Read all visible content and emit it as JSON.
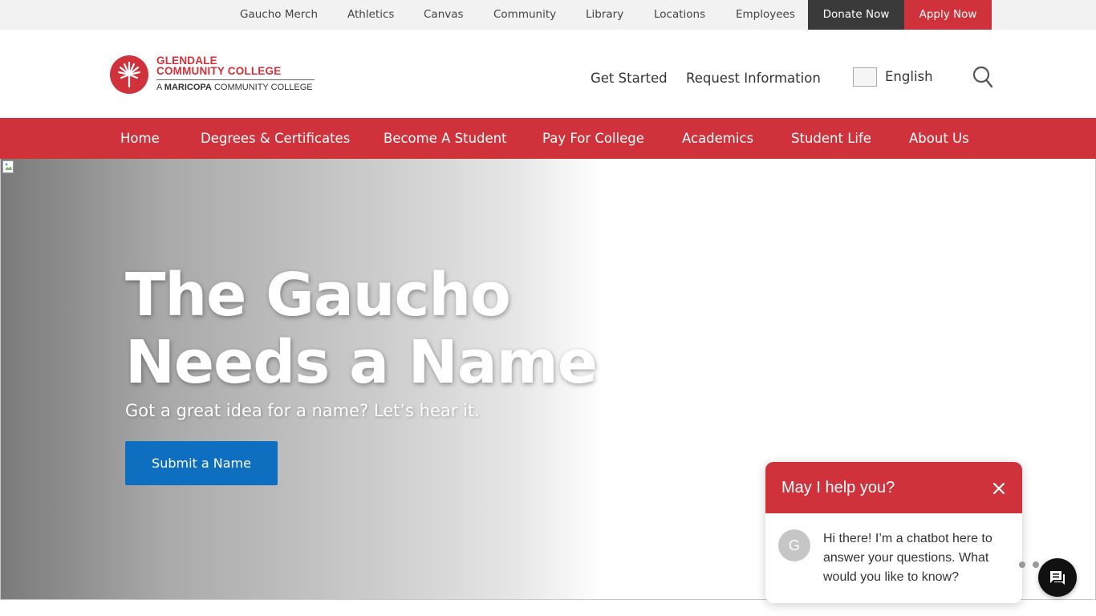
{
  "utility": {
    "links": [
      "Gaucho Merch",
      "Athletics",
      "Canvas",
      "Community",
      "Library",
      "Locations",
      "Employees"
    ],
    "donate": "Donate Now",
    "apply": "Apply Now",
    "colors": {
      "donate_bg": "#3a3a3a",
      "apply_bg": "#d0323b"
    }
  },
  "logo": {
    "line1": "GLENDALE",
    "line2": "COMMUNITY COLLEGE",
    "line3_prefix": "A",
    "line3_bold": "MARICOPA",
    "line3_suffix": "COMMUNITY COLLEGE",
    "icon": "palm-seal-icon"
  },
  "header": {
    "get_started": "Get Started",
    "request_info": "Request Information",
    "language": "English",
    "search_icon": "search-icon"
  },
  "nav": {
    "items": [
      "Home",
      "Degrees & Certificates",
      "Become A Student",
      "Pay For College",
      "Academics",
      "Student Life",
      "About Us"
    ],
    "color": "#d0323b"
  },
  "hero": {
    "title": "The Gaucho Needs a Name",
    "subtitle": "Got a great idea for a name? Let’s hear it.",
    "button": "Submit a Name",
    "button_color": "#0e6fc0"
  },
  "chat": {
    "title": "May I help you?",
    "avatar_letter": "G",
    "message": "Hi there! I’m a chatbot here to answer your questions. What would you like to know?",
    "launcher_icon": "chat-bubble-icon"
  }
}
